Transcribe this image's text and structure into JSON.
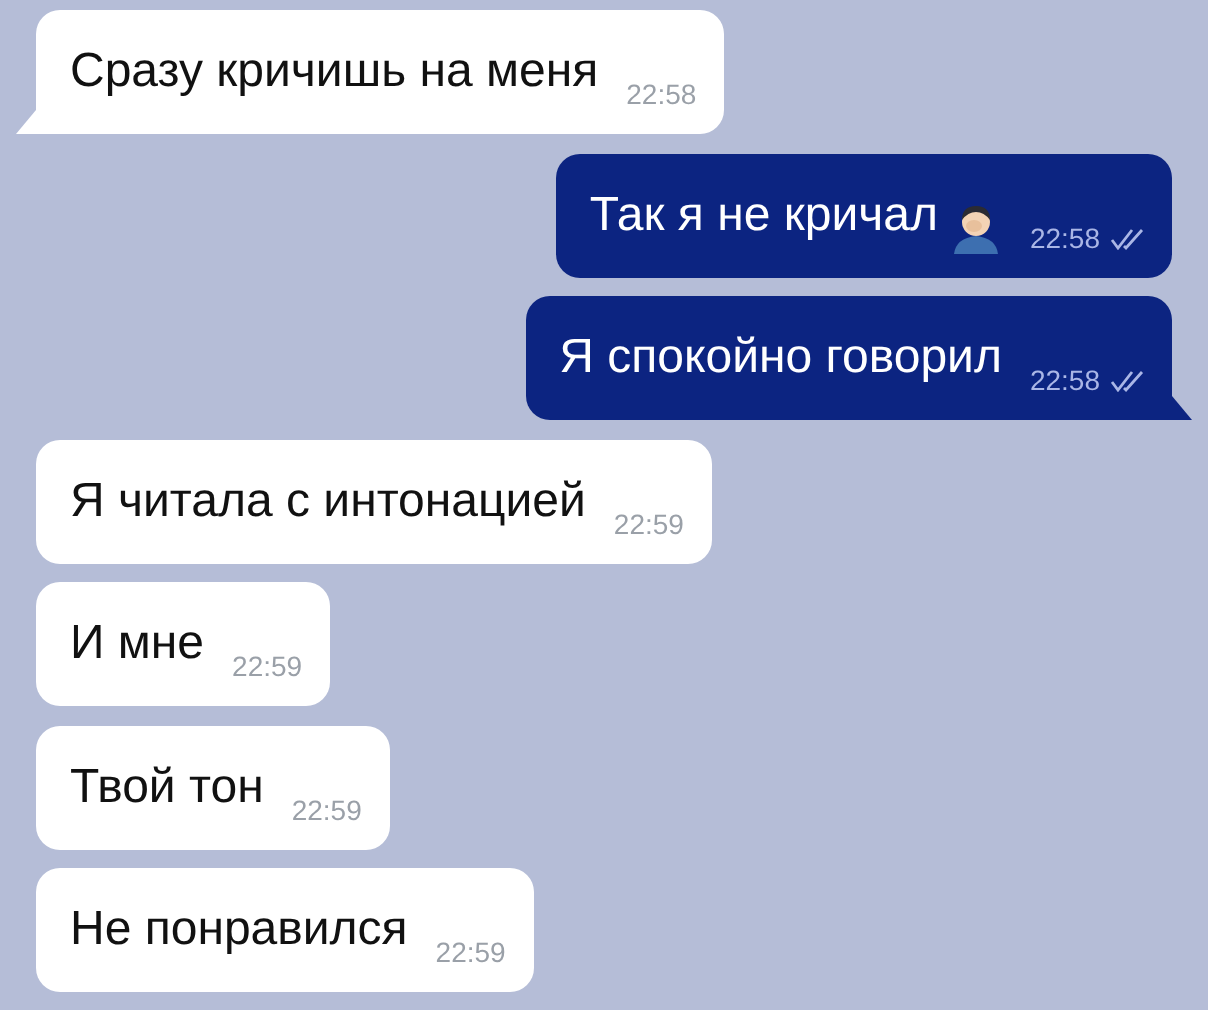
{
  "messages": [
    {
      "kind": "incoming",
      "text": "Сразу кричишь на меня",
      "time": "22:58",
      "tail": true
    },
    {
      "kind": "outgoing",
      "text": "Так я не кричал",
      "emoji": true,
      "time": "22:58",
      "read": true,
      "tail": false
    },
    {
      "kind": "outgoing",
      "text": "Я спокойно говорил",
      "emoji": false,
      "time": "22:58",
      "read": true,
      "tail": true
    },
    {
      "kind": "incoming",
      "text": "Я читала с интонацией",
      "time": "22:59",
      "tail": false
    },
    {
      "kind": "incoming",
      "text": "И мне",
      "time": "22:59",
      "tail": false
    },
    {
      "kind": "incoming",
      "text": "Твой тон",
      "time": "22:59",
      "tail": false
    },
    {
      "kind": "incoming",
      "text": "Не понравился",
      "time": "22:59",
      "tail": false
    }
  ]
}
